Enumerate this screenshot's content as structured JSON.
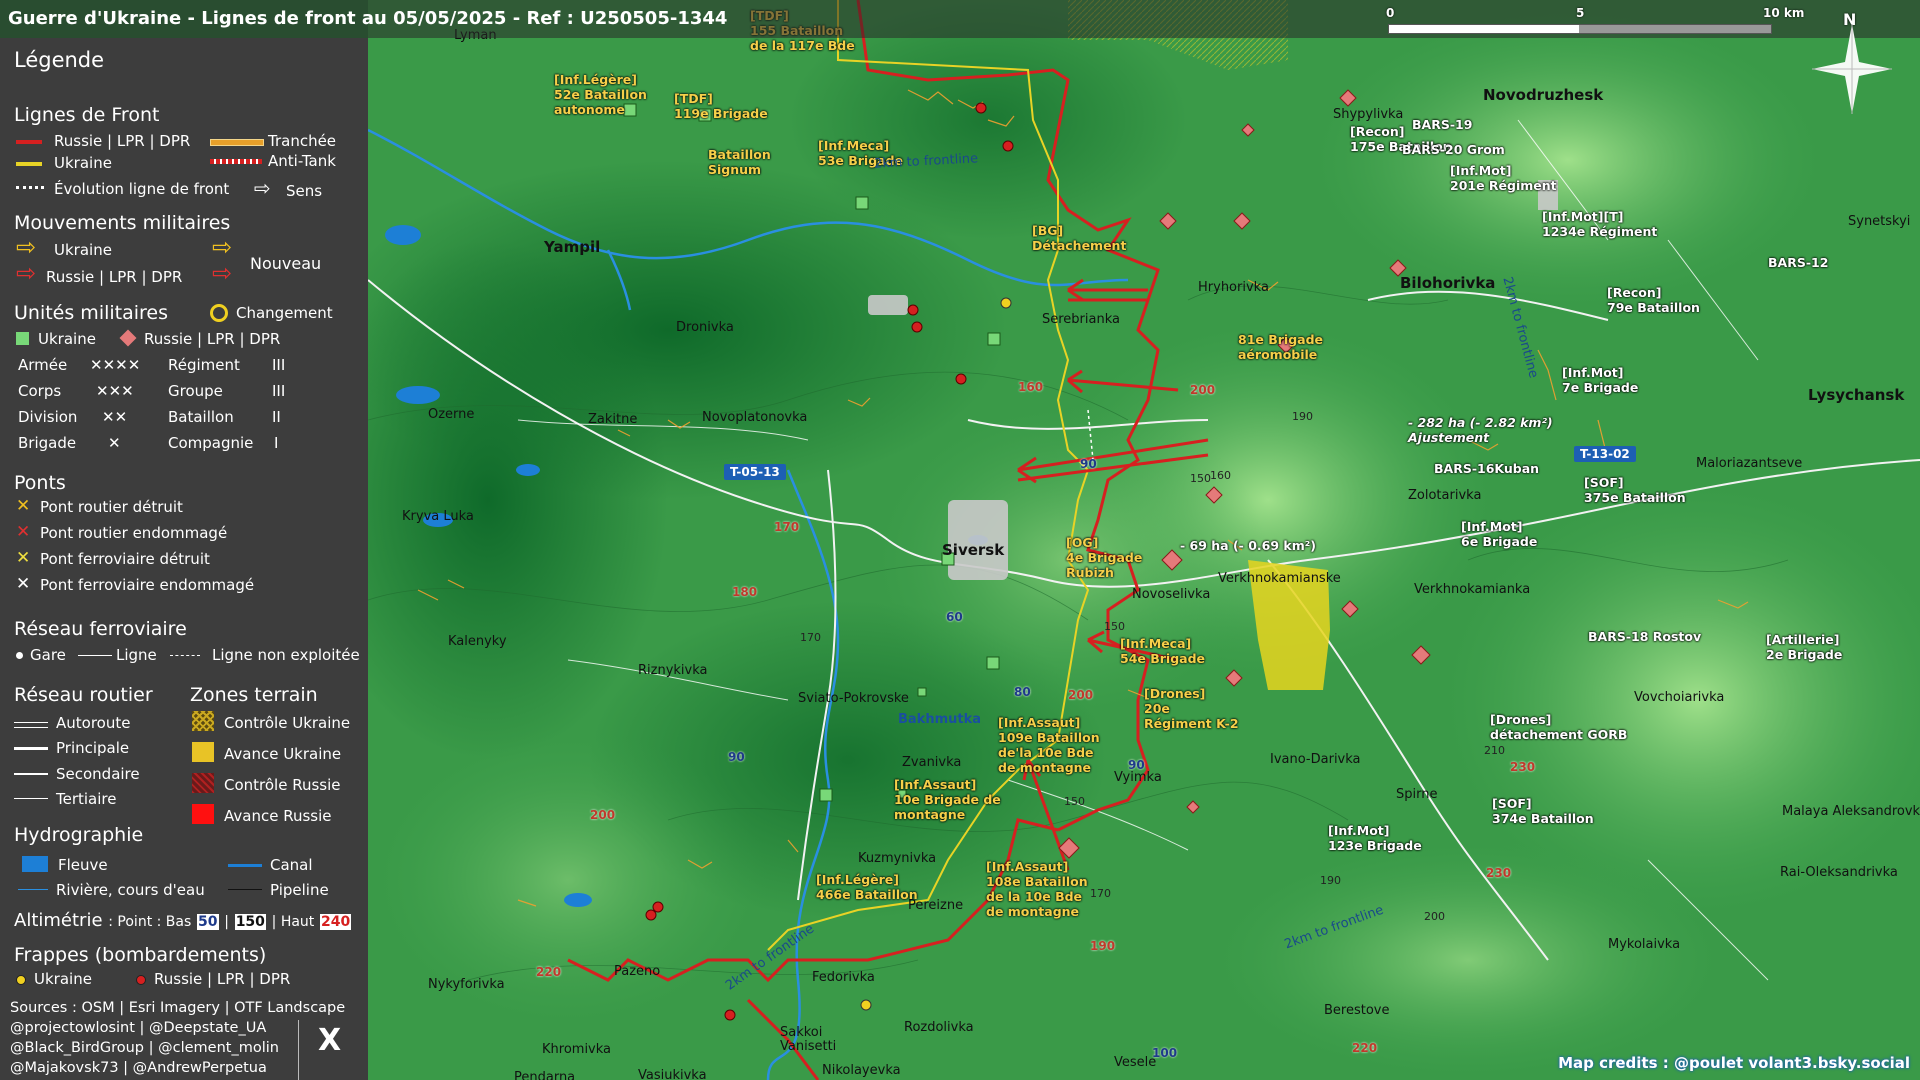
{
  "title": "Guerre d'Ukraine - Lignes de front au 05/05/2025 - Ref : U250505-1344",
  "scale": {
    "zero": "0",
    "mid": "5",
    "end": "10 km"
  },
  "north": "N",
  "legend": {
    "title": "Légende",
    "front": {
      "heading": "Lignes de Front",
      "russia": "Russie | LPR | DPR",
      "ukraine": "Ukraine",
      "trench": "Tranchée",
      "antitank": "Anti-Tank",
      "evolution": "Évolution ligne de front",
      "direction": "Sens"
    },
    "movements": {
      "heading": "Mouvements militaires",
      "ukraine": "Ukraine",
      "russia": "Russie | LPR | DPR",
      "new": "Nouveau"
    },
    "units": {
      "heading": "Unités militaires",
      "change": "Changement",
      "ukraine": "Ukraine",
      "russia": "Russie | LPR | DPR",
      "rows": [
        {
          "a": "Armée",
          "as": "✕✕✕✕",
          "b": "Régiment",
          "bs": "III"
        },
        {
          "a": "Corps",
          "as": "✕✕✕",
          "b": "Groupe",
          "bs": "III"
        },
        {
          "a": "Division",
          "as": "✕✕",
          "b": "Bataillon",
          "bs": "II"
        },
        {
          "a": "Brigade",
          "as": "✕",
          "b": "Compagnie",
          "bs": "I"
        }
      ]
    },
    "bridges": {
      "heading": "Ponts",
      "items": [
        "Pont routier détruit",
        "Pont routier endommagé",
        "Pont ferroviaire détruit",
        "Pont ferroviaire endommagé"
      ]
    },
    "rail": {
      "heading": "Réseau ferroviaire",
      "station": "Gare",
      "line": "Ligne",
      "unused": "Ligne non exploitée"
    },
    "roads": {
      "heading": "Réseau routier",
      "items": [
        "Autoroute",
        "Principale",
        "Secondaire",
        "Tertiaire"
      ]
    },
    "zones": {
      "heading": "Zones terrain",
      "items": [
        "Contrôle Ukraine",
        "Avance Ukraine",
        "Contrôle Russie",
        "Avance Russie"
      ]
    },
    "hydro": {
      "heading": "Hydrographie",
      "river": "Fleuve",
      "canal": "Canal",
      "stream": "Rivière, cours d'eau",
      "pipeline": "Pipeline"
    },
    "altimetry": {
      "label": "Altimétrie",
      "point": ": Point : Bas",
      "low": "50",
      "sep": "|",
      "mid": "150",
      "sep2": "| Haut",
      "high": "240"
    },
    "strikes": {
      "heading": "Frappes (bombardements)",
      "ukraine": "Ukraine",
      "russia": "Russie | LPR | DPR"
    },
    "sources": [
      "Sources : OSM | Esri Imagery | OTF Landscape",
      "@projectowlosint | @Deepstate_UA",
      "@Black_BirdGroup | @clement_molin",
      "@Majakovsk73 | @AndrewPerpetua"
    ],
    "x_logo": "X"
  },
  "places": [
    {
      "name": "Yampil",
      "bold": true
    },
    {
      "name": "Siversk",
      "bold": true
    },
    {
      "name": "Bilohorivka",
      "bold": true
    },
    {
      "name": "Novodruzhesk",
      "bold": true
    },
    {
      "name": "Lysychansk",
      "bold": true
    },
    {
      "name": "Ozerne"
    },
    {
      "name": "Zakitne"
    },
    {
      "name": "Novoplatonovka"
    },
    {
      "name": "Dronivka"
    },
    {
      "name": "Serebrianka"
    },
    {
      "name": "Hryhorivka"
    },
    {
      "name": "Shypylivka"
    },
    {
      "name": "Synetskyi"
    },
    {
      "name": "Kryva Luka"
    },
    {
      "name": "Kalenyky"
    },
    {
      "name": "Riznykivka"
    },
    {
      "name": "Sviato-Pokrovske"
    },
    {
      "name": "Bakhmutka"
    },
    {
      "name": "Zvanivka"
    },
    {
      "name": "Kuzmynivka"
    },
    {
      "name": "Pereizne"
    },
    {
      "name": "Vyimka"
    },
    {
      "name": "Ivano-Darivka"
    },
    {
      "name": "Spirne"
    },
    {
      "name": "Novoselivka"
    },
    {
      "name": "Verkhnokamianske"
    },
    {
      "name": "Verkhnokamianka"
    },
    {
      "name": "Zolotarivka"
    },
    {
      "name": "Maloriazantseve"
    },
    {
      "name": "Vovchoiarivka"
    },
    {
      "name": "Malaya Aleksandrovk"
    },
    {
      "name": "Rai-Oleksandrivka"
    },
    {
      "name": "Mykolaivka"
    },
    {
      "name": "Berestove"
    },
    {
      "name": "Vesele"
    },
    {
      "name": "Rozdolivka"
    },
    {
      "name": "Fedorivka"
    },
    {
      "name": "Pazeno"
    },
    {
      "name": "Nykyforivka"
    },
    {
      "name": "Khromivka"
    },
    {
      "name": "Sakkoi\nVanisetti"
    },
    {
      "name": "Nikolayevka"
    },
    {
      "name": "Vasiukivka"
    },
    {
      "name": "Pendarna"
    },
    {
      "name": "Lyman"
    }
  ],
  "road_shields": [
    "T-05-13",
    "T-13-02"
  ],
  "units_ua": [
    "[TDF]\n155 Bataillon\nde la 117e Bde",
    "[Inf.Légère]\n52e Bataillon\nautonome",
    "[TDF]\n119e Brigade",
    "Bataillon\nSignum",
    "[Inf.Meca]\n53e Brigade",
    "[BG]\nDétachement",
    "81e Brigade\naéromobile",
    "[OG]\n4e Brigade\nRubizh",
    "[Inf.Meca]\n54e Brigade",
    "[Drones]\n20e\nRégiment K-2",
    "[Inf.Assaut]\n109e Bataillon\nde'la 10e Bde\nde montagne",
    "[Inf.Assaut]\n10e Brigade de\nmontagne",
    "[Inf.Assaut]\n108e Bataillon\nde la 10e Bde\nde montagne",
    "[Inf.Légère]\n466e Bataillon"
  ],
  "units_ru": [
    "[Recon]\n175e Bataillon",
    "BARS-19",
    "BARS-20 Grom",
    "[Inf.Mot]\n201e Régiment",
    "[Inf.Mot][T]\n1234e Régiment",
    "BARS-12",
    "[Recon]\n79e Bataillon",
    "[Inf.Mot]\n7e Brigade",
    "BARS-16Kuban",
    "[SOF]\n375e Bataillon",
    "[Inf.Mot]\n6e Brigade",
    "BARS-18 Rostov",
    "[Artillerie]\n2e Brigade",
    "[Drones]\ndétachement GORB",
    "[SOF]\n374e Bataillon",
    "[Inf.Mot]\n123e Brigade"
  ],
  "annotations": [
    {
      "text": "- 282 ha (- 2.82 km²)\nAjustement"
    },
    {
      "text": "- 69 ha (- 0.69 km²)"
    }
  ],
  "frontline_notes": [
    "2km to frontline",
    "2km to frontline",
    "2km to frontline",
    "2km to frontline"
  ],
  "altitudes_red": [
    "160",
    "200",
    "170",
    "180",
    "200",
    "200",
    "220",
    "190",
    "230",
    "230",
    "220",
    "240",
    "200"
  ],
  "altitudes_blue": [
    "90",
    "60",
    "80",
    "90",
    "90",
    "100"
  ],
  "altitudes_black": [
    "190",
    "150",
    "160",
    "170",
    "150",
    "210",
    "150",
    "170",
    "190",
    "200",
    "150"
  ],
  "credits": "Map credits : @poulet volant3.bsky.social",
  "colors": {
    "russia": "#d62020",
    "ukraine": "#f0d020",
    "panel": "#3d3d3d",
    "water": "#1d7fd6",
    "terrain": "#2a8a3c"
  }
}
